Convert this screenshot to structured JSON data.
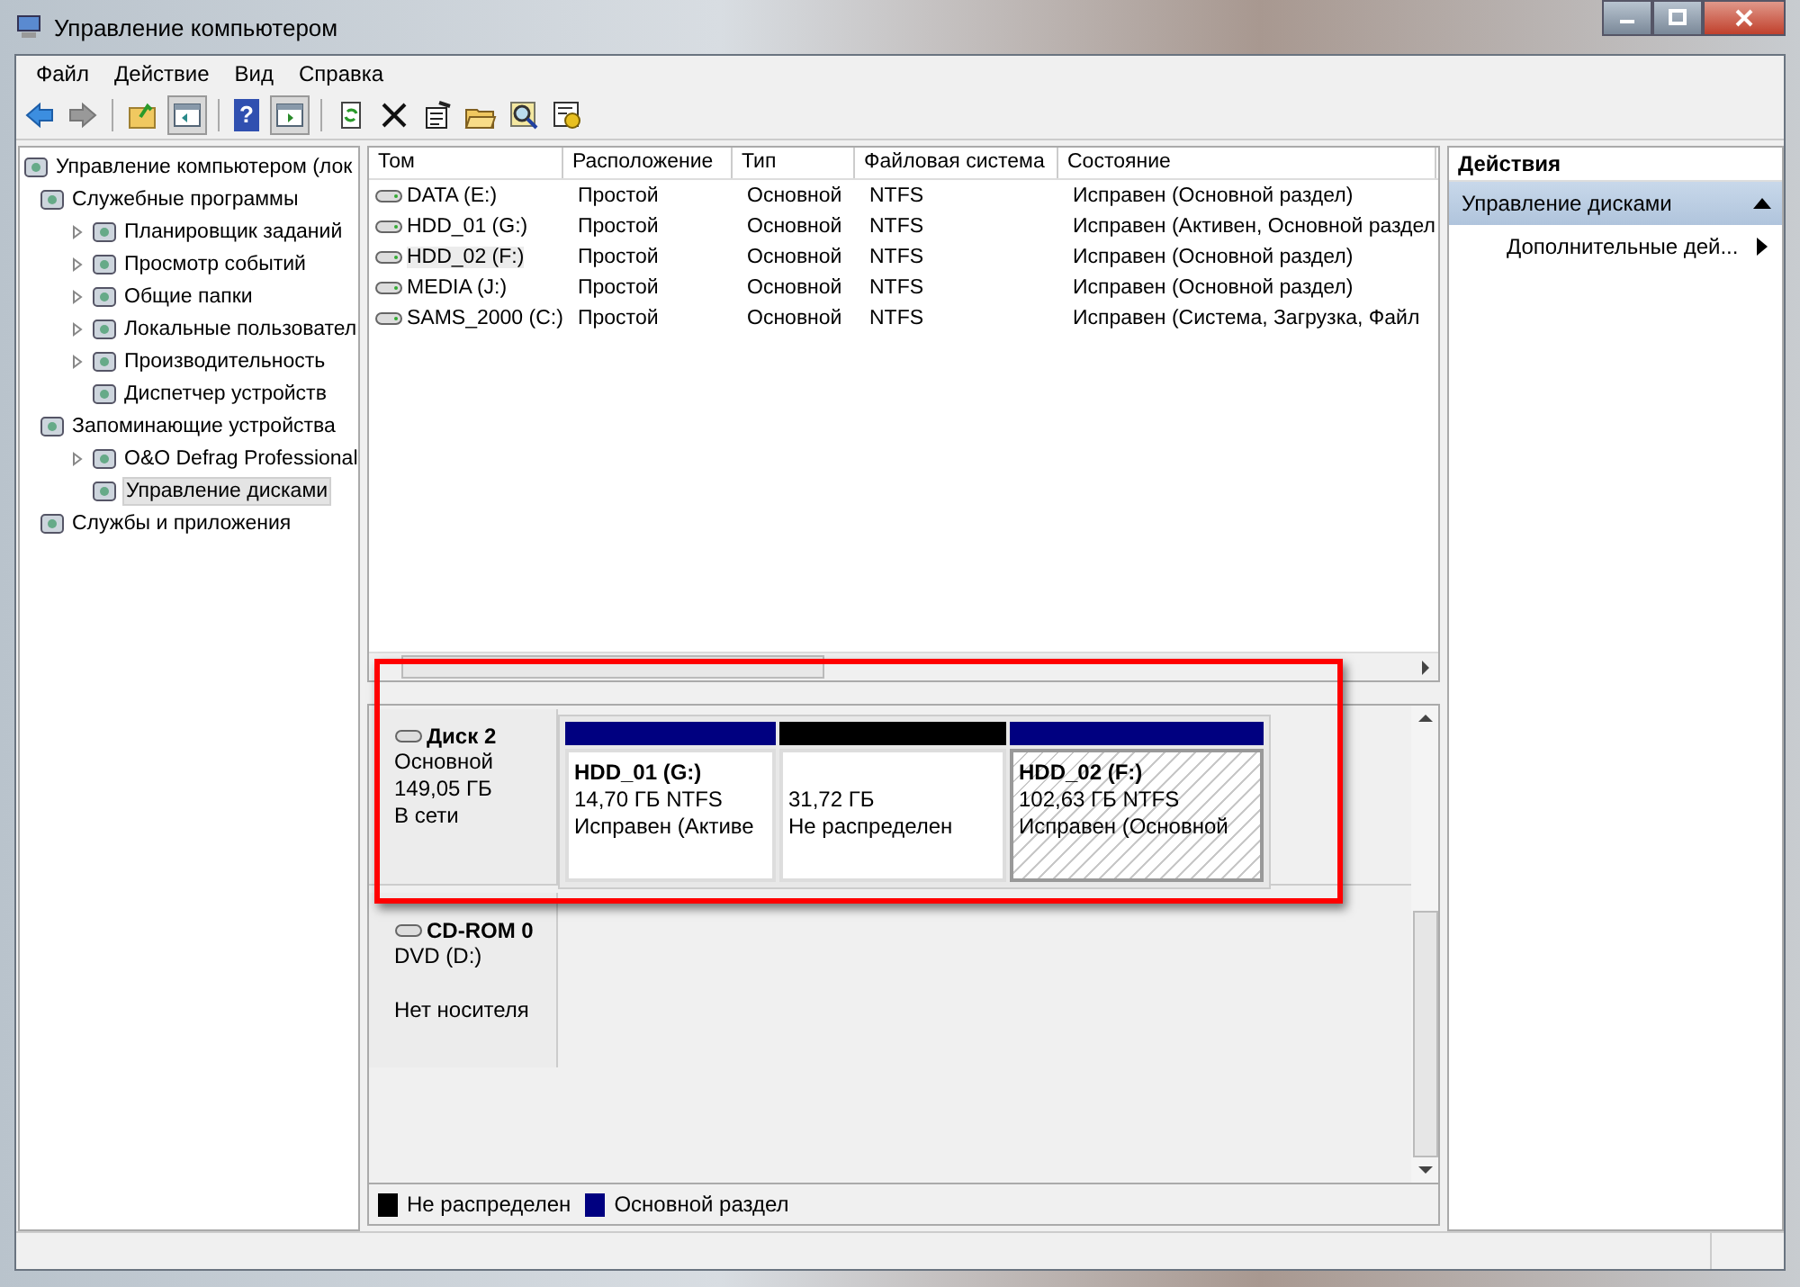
{
  "window": {
    "title": "Управление компьютером"
  },
  "menu": [
    "Файл",
    "Действие",
    "Вид",
    "Справка"
  ],
  "toolbar": {
    "help_glyph": "?"
  },
  "tree": [
    {
      "label": "Управление компьютером (лок",
      "selected": false,
      "expandable": false,
      "children": [
        {
          "label": "Служебные программы",
          "selected": false,
          "expandable": false,
          "children": [
            {
              "label": "Планировщик заданий",
              "selected": false,
              "expandable": true
            },
            {
              "label": "Просмотр событий",
              "selected": false,
              "expandable": true
            },
            {
              "label": "Общие папки",
              "selected": false,
              "expandable": true
            },
            {
              "label": "Локальные пользовател",
              "selected": false,
              "expandable": true
            },
            {
              "label": "Производительность",
              "selected": false,
              "expandable": true
            },
            {
              "label": "Диспетчер устройств",
              "selected": false,
              "expandable": false
            }
          ]
        },
        {
          "label": "Запоминающие устройства",
          "selected": false,
          "expandable": false,
          "children": [
            {
              "label": "O&O Defrag Professional",
              "selected": false,
              "expandable": true
            },
            {
              "label": "Управление дисками",
              "selected": true,
              "expandable": false
            }
          ]
        },
        {
          "label": "Службы и приложения",
          "selected": false,
          "expandable": false
        }
      ]
    }
  ],
  "table": {
    "columns": [
      "Том",
      "Расположение",
      "Тип",
      "Файловая система",
      "Состояние"
    ],
    "rows": [
      {
        "selected": false,
        "cells": [
          "DATA (E:)",
          "Простой",
          "Основной",
          "NTFS",
          "Исправен (Основной раздел)"
        ]
      },
      {
        "selected": false,
        "cells": [
          "HDD_01 (G:)",
          "Простой",
          "Основной",
          "NTFS",
          "Исправен (Активен, Основной раздел"
        ]
      },
      {
        "selected": true,
        "cells": [
          "HDD_02 (F:)",
          "Простой",
          "Основной",
          "NTFS",
          "Исправен (Основной раздел)"
        ]
      },
      {
        "selected": false,
        "cells": [
          "MEDIA (J:)",
          "Простой",
          "Основной",
          "NTFS",
          "Исправен (Основной раздел)"
        ]
      },
      {
        "selected": false,
        "cells": [
          "SAMS_2000 (C:)",
          "Простой",
          "Основной",
          "NTFS",
          "Исправен (Система, Загрузка, Файл"
        ]
      }
    ]
  },
  "disks": [
    {
      "name": "Диск 2",
      "lines": [
        "Основной",
        "149,05 ГБ",
        "В сети"
      ],
      "partitions": [
        {
          "name": "HDD_01  (G:)",
          "size": "14,70 ГБ NTFS",
          "status": "Исправен (Активе",
          "color": "#000080",
          "selected": false
        },
        {
          "size": "31,72 ГБ",
          "status": "Не распределен",
          "color": "#000000",
          "selected": false
        },
        {
          "name": "HDD_02  (F:)",
          "size": "102,63 ГБ NTFS",
          "status": "Исправен (Основной",
          "color": "#000080",
          "selected": true
        }
      ]
    },
    {
      "name": "CD-ROM 0",
      "lines": [
        "DVD (D:)",
        "Нет носителя"
      ]
    }
  ],
  "legend": [
    {
      "label": "Не распределен",
      "color": "#000000"
    },
    {
      "label": "Основной раздел",
      "color": "#000080"
    }
  ],
  "actions": {
    "title": "Действия",
    "section": "Управление дисками",
    "items": [
      "Дополнительные дей..."
    ]
  }
}
